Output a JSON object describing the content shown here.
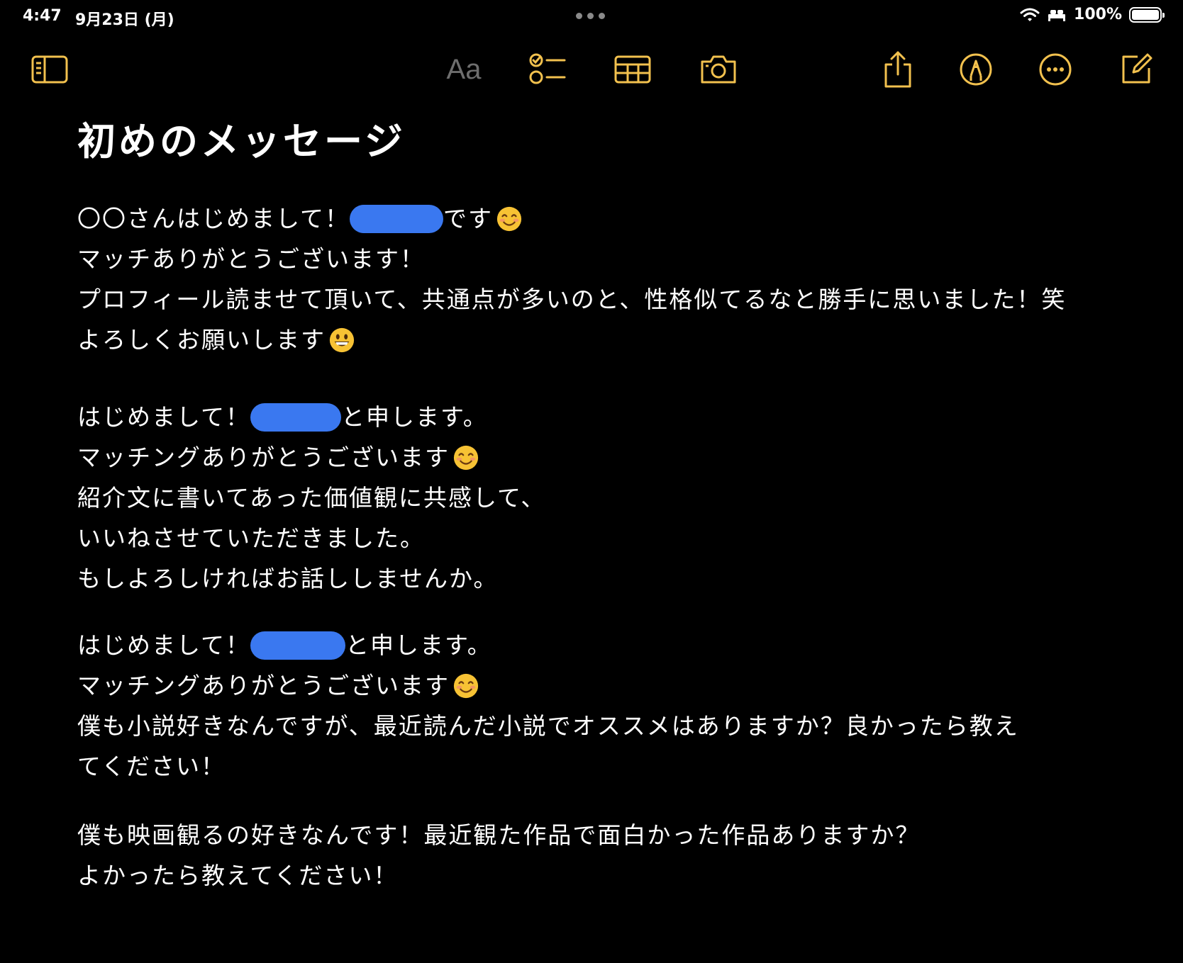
{
  "status_bar": {
    "time": "4:47",
    "date": "9月23日 (月)",
    "battery_pct": "100%",
    "battery_level": 1.0
  },
  "toolbar": {
    "format_label": "Aa",
    "accent": "#f2c14e",
    "icons": [
      "sidebar-icon",
      "format-icon",
      "checklist-icon",
      "table-icon",
      "camera-icon",
      "share-icon",
      "markup-icon",
      "more-icon",
      "compose-icon"
    ]
  },
  "note": {
    "title": "初めのメッセージ",
    "redaction_color": "#3a78f0",
    "paragraphs": [
      {
        "lines": [
          {
            "before": "〇〇さんはじめまして！",
            "redacted": true,
            "after": "です",
            "emoji": "smiling-face"
          },
          {
            "text": "マッチありがとうございます！"
          },
          {
            "text": "プロフィール読ませて頂いて、共通点が多いのと、性格似てるなと勝手に思いました！笑"
          },
          {
            "text": "よろしくお願いします",
            "emoji": "grinning-face"
          }
        ]
      },
      {
        "lines": [
          {
            "before": "はじめまして！",
            "redacted": true,
            "after": "と申します。"
          },
          {
            "text": "マッチングありがとうございます",
            "emoji": "smiling-face"
          },
          {
            "text": "紹介文に書いてあった価値観に共感して、"
          },
          {
            "text": "いいねさせていただきました。"
          },
          {
            "text": "もしよろしければお話ししませんか。"
          }
        ]
      },
      {
        "lines": [
          {
            "before": "はじめまして！",
            "redacted": true,
            "after": "と申します。"
          },
          {
            "text": "マッチングありがとうございます",
            "emoji": "smiling-face"
          },
          {
            "text": "僕も小説好きなんですが、最近読んだ小説でオススメはありますか？良かったら教え"
          },
          {
            "text": "てください！"
          }
        ]
      },
      {
        "lines": [
          {
            "text": "僕も映画観るの好きなんです！最近観た作品で面白かった作品ありますか？"
          },
          {
            "text": "よかったら教えてください！"
          }
        ]
      }
    ]
  }
}
